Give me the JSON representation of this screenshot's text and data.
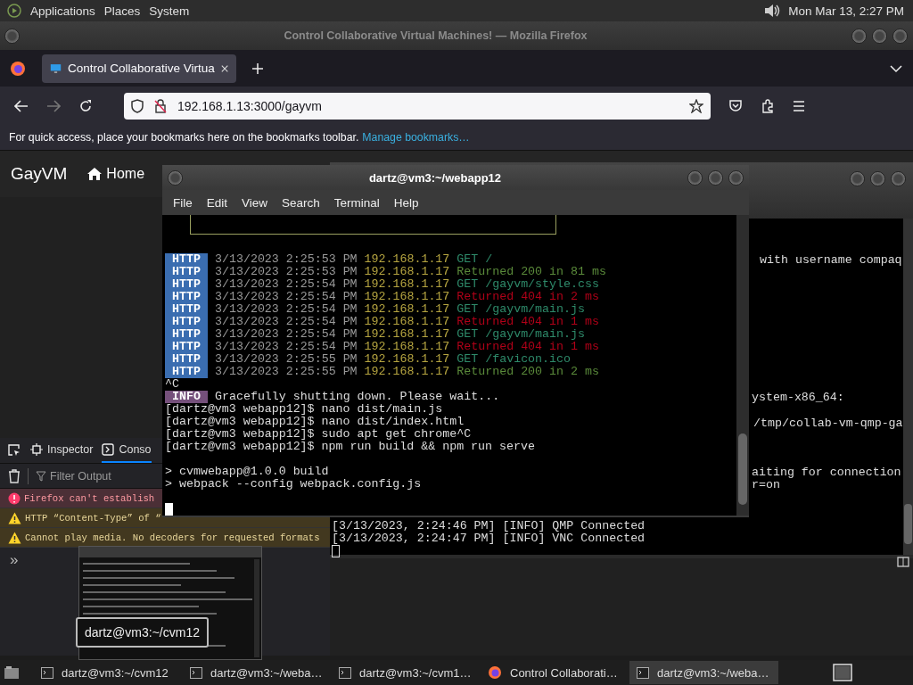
{
  "top_panel": {
    "menus": [
      "Applications",
      "Places",
      "System"
    ],
    "clock": "Mon Mar 13, 2:27 PM"
  },
  "browser": {
    "title": "Control Collaborative Virtual Machines! — Mozilla Firefox",
    "tabs": [
      {
        "label": "Control Collaborative Virtua",
        "selected": true
      }
    ],
    "url": "192.168.1.13:3000/gayvm",
    "bookmarks_hint": "For quick access, place your bookmarks here on the bookmarks toolbar.",
    "bookmarks_link": "Manage bookmarks…",
    "site": {
      "brand": "GayVM",
      "nav": [
        "Home"
      ]
    },
    "devtools": {
      "tabs": [
        {
          "label": "Inspector",
          "selected": false
        },
        {
          "label": "Conso",
          "selected": true
        }
      ],
      "filter_placeholder": "Filter Output",
      "messages": [
        {
          "kind": "error",
          "text": "Firefox can't establish"
        },
        {
          "kind": "warning",
          "text": "HTTP “Content-Type” of “"
        },
        {
          "kind": "warning",
          "text": "Cannot play media. No decoders for requested formats"
        }
      ],
      "more": "»"
    }
  },
  "background_terminal": {
    "lines": [
      "with username compaq",
      "ystem-x86_64:",
      "/tmp/collab-vm-qmp-ga",
      "aiting for connection",
      "r=on",
      "[3/13/2023, 2:24:46 PM] [INFO] QMP Connected",
      "[3/13/2023, 2:24:47 PM] [INFO] VNC Connected"
    ]
  },
  "terminal": {
    "title": "dartz@vm3:~/webapp12",
    "menus": [
      "File",
      "Edit",
      "View",
      "Search",
      "Terminal",
      "Help"
    ],
    "log": [
      {
        "tag": "HTTP",
        "time": "3/13/2023 2:25:53 PM",
        "ip": "192.168.1.17",
        "message": "GET /",
        "kind": "request"
      },
      {
        "tag": "HTTP",
        "time": "3/13/2023 2:25:53 PM",
        "ip": "192.168.1.17",
        "message": "Returned 200 in 81 ms",
        "kind": "ok"
      },
      {
        "tag": "HTTP",
        "time": "3/13/2023 2:25:54 PM",
        "ip": "192.168.1.17",
        "message": "GET /gayvm/style.css",
        "kind": "request"
      },
      {
        "tag": "HTTP",
        "time": "3/13/2023 2:25:54 PM",
        "ip": "192.168.1.17",
        "message": "Returned 404 in 2 ms",
        "kind": "error"
      },
      {
        "tag": "HTTP",
        "time": "3/13/2023 2:25:54 PM",
        "ip": "192.168.1.17",
        "message": "GET /gayvm/main.js",
        "kind": "request"
      },
      {
        "tag": "HTTP",
        "time": "3/13/2023 2:25:54 PM",
        "ip": "192.168.1.17",
        "message": "Returned 404 in 1 ms",
        "kind": "error"
      },
      {
        "tag": "HTTP",
        "time": "3/13/2023 2:25:54 PM",
        "ip": "192.168.1.17",
        "message": "GET /gayvm/main.js",
        "kind": "request"
      },
      {
        "tag": "HTTP",
        "time": "3/13/2023 2:25:54 PM",
        "ip": "192.168.1.17",
        "message": "Returned 404 in 1 ms",
        "kind": "error"
      },
      {
        "tag": "HTTP",
        "time": "3/13/2023 2:25:55 PM",
        "ip": "192.168.1.17",
        "message": "GET /favicon.ico",
        "kind": "request"
      },
      {
        "tag": "HTTP",
        "time": "3/13/2023 2:25:55 PM",
        "ip": "192.168.1.17",
        "message": "Returned 200 in 2 ms",
        "kind": "ok"
      }
    ],
    "output": [
      {
        "kind": "plain",
        "text": "^C"
      },
      {
        "kind": "info",
        "tag": "INFO",
        "text": "Gracefully shutting down. Please wait..."
      },
      {
        "kind": "plain",
        "text": "[dartz@vm3 webapp12]$ nano dist/main.js"
      },
      {
        "kind": "plain",
        "text": "[dartz@vm3 webapp12]$ nano dist/index.html"
      },
      {
        "kind": "plain",
        "text": "[dartz@vm3 webapp12]$ sudo apt get chrome^C"
      },
      {
        "kind": "plain",
        "text": "[dartz@vm3 webapp12]$ npm run build && npm run serve"
      },
      {
        "kind": "plain",
        "text": "> cvmwebapp@1.0.0 build",
        "spaced": true
      },
      {
        "kind": "plain",
        "text": "> webpack --config webpack.config.js"
      },
      {
        "kind": "cursor",
        "spaced": true
      }
    ]
  },
  "tooltip": {
    "label": "dartz@vm3:~/cvm12"
  },
  "taskbar": {
    "items": [
      {
        "kind": "terminal",
        "label": "dartz@vm3:~/cvm12",
        "selected": false
      },
      {
        "kind": "terminal",
        "label": "dartz@vm3:~/weba…",
        "selected": false
      },
      {
        "kind": "terminal",
        "label": "dartz@vm3:~/cvm1…",
        "selected": false
      },
      {
        "kind": "browser",
        "label": "Control Collaborati…",
        "selected": false
      },
      {
        "kind": "terminal",
        "label": "dartz@vm3:~/weba…",
        "selected": true
      }
    ]
  }
}
